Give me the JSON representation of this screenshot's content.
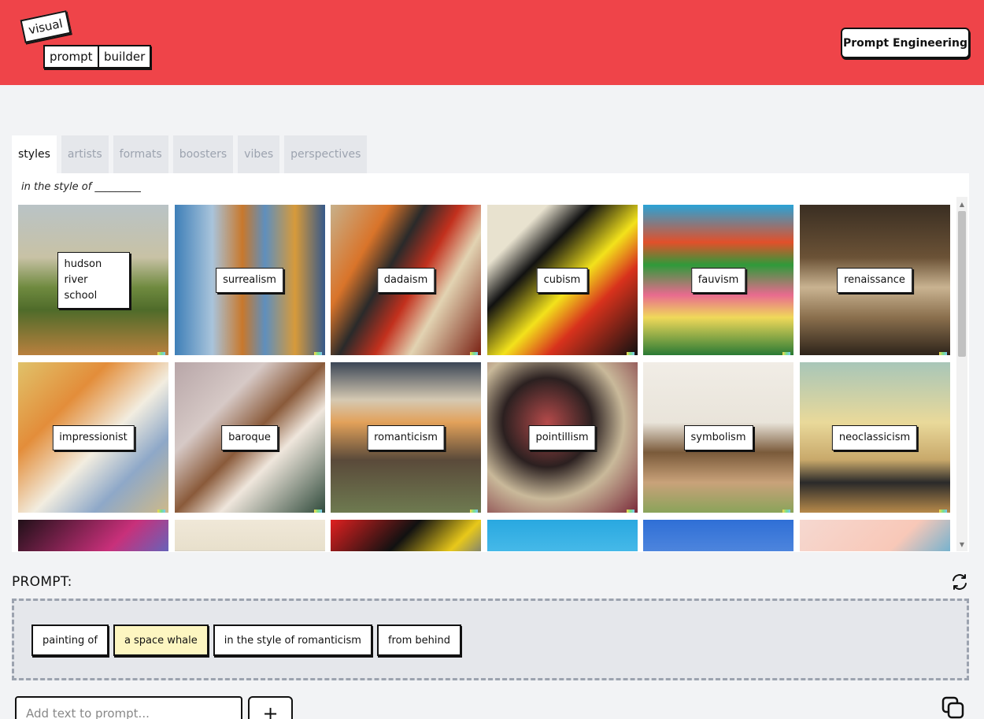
{
  "header": {
    "logo": {
      "word1": "visual",
      "word2": "prompt",
      "word3": "builder"
    },
    "button_label": "Prompt Engineering"
  },
  "tabs": [
    {
      "label": "styles",
      "active": true
    },
    {
      "label": "artists",
      "active": false
    },
    {
      "label": "formats",
      "active": false
    },
    {
      "label": "boosters",
      "active": false
    },
    {
      "label": "vibes",
      "active": false
    },
    {
      "label": "perspectives",
      "active": false
    }
  ],
  "panel": {
    "hint": "in the style of _________",
    "tiles": [
      {
        "label": "hudson river school",
        "bg": "linear-gradient(180deg,#b9c3c6 0%,#c8c2a5 35%,#6f8a3f 55%,#4f6b2a 70%,#b9803e 100%)"
      },
      {
        "label": "surrealism",
        "bg": "linear-gradient(90deg,#3e7fb8 0%,#a9c4db 25%,#c8782c 45%,#5f8fbd 60%,#d79a3a 80%,#36598a 100%)"
      },
      {
        "label": "dadaism",
        "bg": "linear-gradient(120deg,#c7b08a 0%,#d9742a 25%,#2a2a2a 40%,#c2301d 55%,#e2d3b2 70%,#7a2214 100%)"
      },
      {
        "label": "cubism",
        "bg": "linear-gradient(135deg,#e8e2cf 0%,#e8e2cf 20%,#111 35%,#f3e21b 55%,#d8321c 70%,#111 100%)"
      },
      {
        "label": "fauvism",
        "bg": "linear-gradient(180deg,#2aa3d6 0%,#e2502a 25%,#2f9a3a 40%,#e86b8f 60%,#f0d95a 75%,#2a7a34 100%)"
      },
      {
        "label": "renaissance",
        "bg": "linear-gradient(180deg,#3a2e22 0%,#6b5236 35%,#c9b391 55%,#8a6f4d 75%,#2e241a 100%)"
      },
      {
        "label": "impressionist",
        "bg": "linear-gradient(135deg,#e0c26a 0%,#e38d3a 30%,#f2ede0 55%,#8ea8c8 75%,#cdb98a 100%)"
      },
      {
        "label": "baroque",
        "bg": "linear-gradient(135deg,#b8a6a8 0%,#d6c9c6 30%,#8a5a3a 50%,#efe6dc 65%,#2f4a3b 100%)"
      },
      {
        "label": "romanticism",
        "bg": "linear-gradient(180deg,#3b4656 0%,#d5c9b2 25%,#e2a15a 40%,#5a4a3a 65%,#6e7a50 100%)"
      },
      {
        "label": "pointillism",
        "bg": "radial-gradient(circle at 40% 40%,#b54a4a 0%,#2b2020 35%,#c9b99a 60%,#7a2a3a 100%)"
      },
      {
        "label": "symbolism",
        "bg": "linear-gradient(180deg,#f1ede6 0%,#e9e4da 40%,#7a5a3a 60%,#c9a27a 80%,#8aa35a 100%)"
      },
      {
        "label": "neoclassicism",
        "bg": "linear-gradient(180deg,#a8c6b8 0%,#e9d99a 40%,#c8a86a 65%,#2a2a2a 80%,#b78a4a 100%)"
      },
      {
        "label": "",
        "bg": "linear-gradient(135deg,#201018 0%,#c8307a 40%,#3a7ad6 70%,#181020 100%)"
      },
      {
        "label": "",
        "bg": "linear-gradient(180deg,#f0e8d8 0%,#e8e0cc 20%,#2a3a7a 30%,#6a7ab8 60%,#d8d0c0 100%)"
      },
      {
        "label": "",
        "bg": "linear-gradient(135deg,#e02020 0%,#111 30%,#e8c81a 50%,#2a4ab8 70%,#e02020 100%)"
      },
      {
        "label": "",
        "bg": "linear-gradient(180deg,#29a8e0 0%,#5fc8f0 40%,#f0a020 70%,#fff 100%)"
      },
      {
        "label": "",
        "bg": "linear-gradient(180deg,#2f6fd6 0%,#5a8ee0 30%,#f0d020 60%,#fff 100%)"
      },
      {
        "label": "",
        "bg": "linear-gradient(135deg,#f6d8d0 0%,#f8c8b8 40%,#3aa8d8 70%,#fbe6de 100%)"
      }
    ]
  },
  "prompt": {
    "title": "PROMPT:",
    "chips": [
      {
        "label": "painting of",
        "highlight": false
      },
      {
        "label": "a space whale",
        "highlight": true
      },
      {
        "label": "in the style of romanticism",
        "highlight": false
      },
      {
        "label": "from behind",
        "highlight": false
      }
    ],
    "input_placeholder": "Add text to prompt...",
    "add_label": "+"
  },
  "icons": {
    "reset": "refresh-icon",
    "copy": "copy-icon"
  }
}
